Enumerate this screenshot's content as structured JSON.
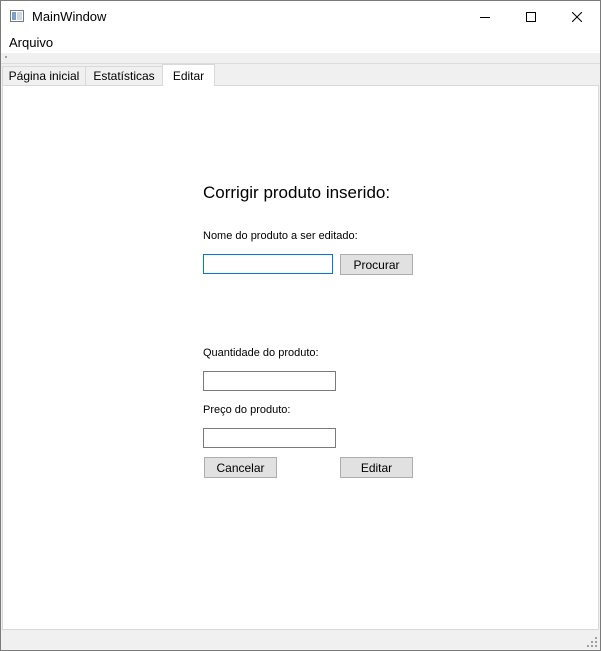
{
  "window": {
    "title": "MainWindow",
    "icon": "app-window-icon",
    "controls": [
      "minimize-icon",
      "maximize-icon",
      "close-icon"
    ]
  },
  "menubar": {
    "items": [
      {
        "label": "Arquivo"
      }
    ]
  },
  "tabs": [
    {
      "label": "Página inicial",
      "active": false
    },
    {
      "label": "Estatísticas",
      "active": false
    },
    {
      "label": "Editar",
      "active": true
    }
  ],
  "edit_form": {
    "heading": "Corrigir produto inserido:",
    "product_name_label": "Nome do produto a ser editado:",
    "product_name_value": "",
    "search_button": "Procurar",
    "quantity_label": "Quantidade do produto:",
    "quantity_value": "",
    "price_label": "Preço do produto:",
    "price_value": "",
    "cancel_button": "Cancelar",
    "edit_button": "Editar"
  },
  "colors": {
    "focus_border": "#0078d7",
    "window_bg": "#f0f0f0",
    "button_bg": "#e1e1e1"
  }
}
